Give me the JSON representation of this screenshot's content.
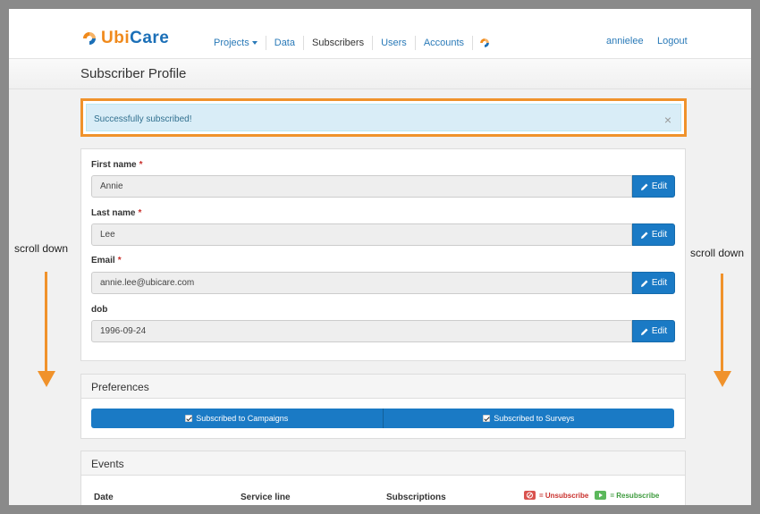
{
  "brand": {
    "name_part1": "Ubi",
    "name_part2": "Care",
    "accent": "#f08a1c",
    "brand_blue": "#1b6fb7"
  },
  "nav": {
    "items": [
      {
        "label": "Projects",
        "dropdown": true
      },
      {
        "label": "Data"
      },
      {
        "label": "Subscribers",
        "active": true
      },
      {
        "label": "Users"
      },
      {
        "label": "Accounts"
      }
    ],
    "user": "annielee",
    "logout": "Logout"
  },
  "page": {
    "title": "Subscriber Profile"
  },
  "alert": {
    "message": "Successfully subscribed!",
    "close": "×"
  },
  "form": {
    "fields": [
      {
        "label": "First name",
        "required": "*",
        "value": "Annie",
        "button": "Edit"
      },
      {
        "label": "Last name",
        "required": "*",
        "value": "Lee",
        "button": "Edit"
      },
      {
        "label": "Email",
        "required": "*",
        "value": "annie.lee@ubicare.com",
        "button": "Edit"
      },
      {
        "label": "dob",
        "required": "",
        "value": "1996-09-24",
        "button": "Edit"
      }
    ]
  },
  "preferences": {
    "heading": "Preferences",
    "campaigns": "Subscribed to Campaigns",
    "surveys": "Subscribed to Surveys"
  },
  "events": {
    "heading": "Events",
    "columns": [
      "Date",
      "Service line",
      "Subscriptions"
    ],
    "legend_unsubscribe": "= Unsubscribe",
    "legend_resubscribe": "= Resubscribe"
  },
  "annotations": {
    "left": "scroll down",
    "right": "scroll down",
    "arrow_color": "#f0922b"
  }
}
